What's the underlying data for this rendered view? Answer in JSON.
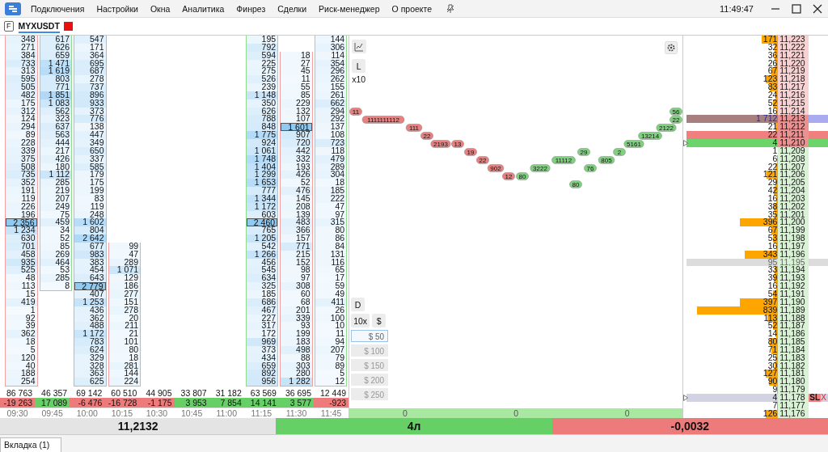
{
  "menu": {
    "items": [
      "Подключения",
      "Настройки",
      "Окна",
      "Аналитика",
      "Финрез",
      "Сделки",
      "Риск-менеджер",
      "О проекте"
    ],
    "clock": "11:49:47"
  },
  "tab": {
    "badge": "F",
    "symbol": "MYXUSDT"
  },
  "clusters": {
    "columns": [
      {
        "time": "09:30",
        "up": false,
        "volume": "86 763",
        "delta": "-19 263",
        "delta_positive": false,
        "cells": [
          "348",
          "271",
          "384",
          "733",
          "313",
          "595",
          "505",
          "482",
          "175",
          "312",
          "124",
          "294",
          "89",
          "228",
          "339",
          "375",
          "508",
          "735",
          "352",
          "191",
          "119",
          "226",
          "196",
          {
            "text": "2 356",
            "poc": true
          },
          "1 234",
          "630",
          "701",
          "458",
          "935",
          "525",
          "48",
          "113",
          "15",
          "419",
          "1",
          "92",
          "39",
          "362",
          "18",
          "5",
          "120",
          "40",
          "188",
          "254"
        ]
      },
      {
        "time": "09:45",
        "up": true,
        "volume": "46 357",
        "delta": "17 089",
        "delta_positive": true,
        "cells": [
          "617",
          "626",
          "659",
          "1 471",
          "1 619",
          "803",
          "771",
          "1 851",
          "1 083",
          "562",
          "323",
          "637",
          "563",
          "444",
          "217",
          "426",
          "180",
          "1 112",
          "285",
          "219",
          "207",
          "249",
          "75",
          "459",
          "34",
          "52",
          "85",
          "269",
          "464",
          "53",
          "285",
          "8"
        ]
      },
      {
        "time": "10:00",
        "up": false,
        "volume": "69 142",
        "delta": "-6 476",
        "delta_positive": false,
        "cells": [
          "547",
          "171",
          "364",
          "695",
          "687",
          "278",
          "737",
          "896",
          "933",
          "373",
          "776",
          "138",
          "447",
          "349",
          "650",
          "337",
          "585",
          "179",
          "175",
          "199",
          "83",
          "119",
          "248",
          "1 602",
          "804",
          "2 642",
          "677",
          "983",
          "383",
          "454",
          "643",
          {
            "text": "2 779",
            "poc": true
          },
          "407",
          "1 253",
          "436",
          "362",
          "488",
          "1 172",
          "783",
          "624",
          "329",
          "328",
          "363",
          "625"
        ]
      },
      {
        "time": "10:15",
        "up": false,
        "volume": "60 510",
        "delta": "-16 728",
        "delta_positive": false,
        "cells": [
          null,
          null,
          null,
          null,
          null,
          null,
          null,
          null,
          null,
          null,
          null,
          null,
          null,
          null,
          null,
          null,
          null,
          null,
          null,
          null,
          null,
          null,
          null,
          null,
          null,
          null,
          "99",
          "47",
          "289",
          "1 071",
          "129",
          "186",
          "277",
          "151",
          "278",
          "20",
          "211",
          "21",
          "101",
          "80",
          "18",
          "281",
          "144",
          "224"
        ]
      },
      {
        "time": "10:30",
        "volume": "44 905",
        "delta": "-1 175",
        "delta_positive": false
      },
      {
        "time": "10:45",
        "volume": "33 807",
        "delta": "3 953",
        "delta_positive": true
      },
      {
        "time": "11:00",
        "volume": "31 182",
        "delta": "7 854",
        "delta_positive": true
      },
      {
        "time": "11:15",
        "up": true,
        "volume": "63 569",
        "delta": "14 141",
        "delta_positive": true,
        "cells": [
          "195",
          "792",
          "594",
          "225",
          "275",
          "526",
          "239",
          "1 148",
          "350",
          "626",
          "788",
          "848",
          "1 775",
          "924",
          "1 061",
          "1 748",
          "1 404",
          "1 299",
          "1 653",
          "777",
          "1 344",
          "1 172",
          "603",
          {
            "text": "2 460",
            "poc": true
          },
          "765",
          "1 205",
          "542",
          "1 266",
          "456",
          "545",
          "634",
          "325",
          "185",
          "686",
          "467",
          "227",
          "317",
          "172",
          "969",
          "373",
          "434",
          "659",
          "892",
          "956"
        ]
      },
      {
        "time": "11:30",
        "up": false,
        "volume": "36 695",
        "delta": "3 577",
        "delta_positive": true,
        "cells": [
          null,
          null,
          "18",
          "27",
          "45",
          "11",
          "55",
          "85",
          "229",
          "132",
          "107",
          {
            "text": "1 601",
            "poc": true
          },
          "907",
          "720",
          "442",
          "332",
          "193",
          "426",
          "52",
          "476",
          "145",
          "208",
          "139",
          "483",
          "366",
          "157",
          "771",
          "215",
          "152",
          "98",
          "97",
          "308",
          "60",
          "68",
          "201",
          "339",
          "93",
          "199",
          "183",
          "498",
          "88",
          "303",
          "280",
          "1 282"
        ]
      },
      {
        "time": "11:45",
        "up": true,
        "volume": "12 449",
        "delta": "-923",
        "delta_positive": false,
        "cells": [
          "144",
          "306",
          "114",
          "354",
          "296",
          "262",
          "155",
          "261",
          "662",
          "294",
          "292",
          "137",
          "108",
          "723",
          "118",
          "479",
          "289",
          "304",
          "18",
          "185",
          "222",
          "47",
          "97",
          "315",
          "80",
          "86",
          "84",
          "131",
          "116",
          "65",
          "17",
          "59",
          "49",
          "411",
          "26",
          "100",
          "10",
          "11",
          "94",
          "207",
          "79",
          "89",
          "5",
          "12"
        ]
      }
    ]
  },
  "chart": {
    "top_button": "L",
    "zoom": "x10",
    "bubbles": [
      {
        "label": "11",
        "color": "#e88080"
      },
      {
        "label": "1111111112",
        "color": "#e88080"
      },
      {
        "label": "111",
        "color": "#e88080"
      },
      {
        "label": "22",
        "color": "#e88080"
      },
      {
        "label": "2193",
        "color": "#e88080"
      },
      {
        "label": "13",
        "color": "#e88080"
      },
      {
        "label": "19",
        "color": "#e88080"
      },
      {
        "label": "22",
        "color": "#e88080"
      },
      {
        "label": "902",
        "color": "#e88080"
      },
      {
        "label": "12",
        "color": "#e88080"
      },
      {
        "label": "80",
        "color": "#80d080"
      },
      {
        "label": "3222",
        "color": "#80d080"
      },
      {
        "label": "11112",
        "color": "#80d080"
      },
      {
        "label": "29",
        "color": "#80d080"
      },
      {
        "label": "80",
        "color": "#80d080"
      },
      {
        "label": "76",
        "color": "#80d080"
      },
      {
        "label": "805",
        "color": "#80d080"
      },
      {
        "label": "2",
        "color": "#80d080"
      },
      {
        "label": "5161",
        "color": "#80d080"
      },
      {
        "label": "13214",
        "color": "#80d080"
      },
      {
        "label": "2122",
        "color": "#80d080"
      },
      {
        "label": "22",
        "color": "#80d080"
      },
      {
        "label": "56",
        "color": "#80d080"
      }
    ],
    "mode_button": "D",
    "size_buttons": [
      "10x",
      "$"
    ],
    "amounts": [
      {
        "label": "$ 50",
        "selected": true
      },
      {
        "label": "$ 100",
        "selected": false
      },
      {
        "label": "$ 150",
        "selected": false
      },
      {
        "label": "$ 200",
        "selected": false
      },
      {
        "label": "$ 250",
        "selected": false
      }
    ],
    "footer": [
      "0",
      "0",
      "0"
    ]
  },
  "ladder": {
    "rows": [
      {
        "volume": "171",
        "price": "11,223",
        "bid": false,
        "kind": "normal"
      },
      {
        "volume": "32",
        "price": "11,222",
        "bid": false,
        "kind": "normal"
      },
      {
        "volume": "36",
        "price": "11,221",
        "bid": false,
        "kind": "normal"
      },
      {
        "volume": "26",
        "price": "11,220",
        "bid": false,
        "kind": "normal"
      },
      {
        "volume": "67",
        "price": "11,219",
        "bid": false,
        "kind": "normal"
      },
      {
        "volume": "123",
        "price": "11,218",
        "bid": false,
        "kind": "normal"
      },
      {
        "volume": "83",
        "price": "11,217",
        "bid": false,
        "kind": "normal"
      },
      {
        "volume": "24",
        "price": "11,216",
        "bid": false,
        "kind": "normal"
      },
      {
        "volume": "52",
        "price": "11,215",
        "bid": false,
        "kind": "normal"
      },
      {
        "volume": "16",
        "price": "11,214",
        "bid": false,
        "kind": "normal"
      },
      {
        "volume": "1 712",
        "price": "11,213",
        "bid": false,
        "kind": "max"
      },
      {
        "volume": "21",
        "price": "11,212",
        "bid": false,
        "kind": "inside"
      },
      {
        "volume": "22",
        "price": "11,211",
        "bid": false,
        "kind": "best_ask"
      },
      {
        "volume": "4",
        "price": "11,210",
        "bid": false,
        "kind": "best_bid"
      },
      {
        "volume": "1",
        "price": "11,209",
        "bid": true,
        "kind": "normal"
      },
      {
        "volume": "6",
        "price": "11,208",
        "bid": true,
        "kind": "normal"
      },
      {
        "volume": "22",
        "price": "11,207",
        "bid": true,
        "kind": "normal"
      },
      {
        "volume": "121",
        "price": "11,206",
        "bid": true,
        "kind": "normal"
      },
      {
        "volume": "29",
        "price": "11,205",
        "bid": true,
        "kind": "normal"
      },
      {
        "volume": "42",
        "price": "11,204",
        "bid": true,
        "kind": "normal"
      },
      {
        "volume": "16",
        "price": "11,203",
        "bid": true,
        "kind": "normal"
      },
      {
        "volume": "38",
        "price": "11,202",
        "bid": true,
        "kind": "normal"
      },
      {
        "volume": "35",
        "price": "11,201",
        "bid": true,
        "kind": "normal"
      },
      {
        "volume": "396",
        "price": "11,200",
        "bid": true,
        "kind": "normal"
      },
      {
        "volume": "67",
        "price": "11,199",
        "bid": true,
        "kind": "normal"
      },
      {
        "volume": "53",
        "price": "11,198",
        "bid": true,
        "kind": "normal"
      },
      {
        "volume": "16",
        "price": "11,197",
        "bid": true,
        "kind": "normal"
      },
      {
        "volume": "343",
        "price": "11,196",
        "bid": true,
        "kind": "normal"
      },
      {
        "volume": "95",
        "price": "11,195",
        "bid": true,
        "kind": "marked"
      },
      {
        "volume": "33",
        "price": "11,194",
        "bid": true,
        "kind": "normal"
      },
      {
        "volume": "39",
        "price": "11,193",
        "bid": true,
        "kind": "normal"
      },
      {
        "volume": "16",
        "price": "11,192",
        "bid": true,
        "kind": "normal"
      },
      {
        "volume": "54",
        "price": "11,191",
        "bid": true,
        "kind": "normal"
      },
      {
        "volume": "397",
        "price": "11,190",
        "bid": true,
        "kind": "normal"
      },
      {
        "volume": "839",
        "price": "11,189",
        "bid": true,
        "kind": "normal"
      },
      {
        "volume": "113",
        "price": "11,188",
        "bid": true,
        "kind": "normal"
      },
      {
        "volume": "52",
        "price": "11,187",
        "bid": true,
        "kind": "normal"
      },
      {
        "volume": "14",
        "price": "11,186",
        "bid": true,
        "kind": "normal"
      },
      {
        "volume": "80",
        "price": "11,185",
        "bid": true,
        "kind": "normal"
      },
      {
        "volume": "71",
        "price": "11,184",
        "bid": true,
        "kind": "normal"
      },
      {
        "volume": "25",
        "price": "11,183",
        "bid": true,
        "kind": "normal"
      },
      {
        "volume": "30",
        "price": "11,182",
        "bid": true,
        "kind": "normal"
      },
      {
        "volume": "127",
        "price": "11,181",
        "bid": true,
        "kind": "normal"
      },
      {
        "volume": "90",
        "price": "11,180",
        "bid": true,
        "kind": "normal"
      },
      {
        "volume": "9",
        "price": "11,179",
        "bid": true,
        "kind": "normal"
      },
      {
        "volume": "4",
        "price": "11,178",
        "bid": true,
        "kind": "order",
        "order": "SL",
        "cancel": "X"
      },
      {
        "volume": "7",
        "price": "11,177",
        "bid": true,
        "kind": "normal"
      },
      {
        "volume": "126",
        "price": "11,176",
        "bid": true,
        "kind": "normal"
      }
    ]
  },
  "summary": {
    "price": "11,2132",
    "position": "4л",
    "pnl": "-0,0032"
  },
  "status_bar": {
    "tabs": [
      {
        "label": "Вкладка (1)",
        "selected": true
      }
    ]
  }
}
